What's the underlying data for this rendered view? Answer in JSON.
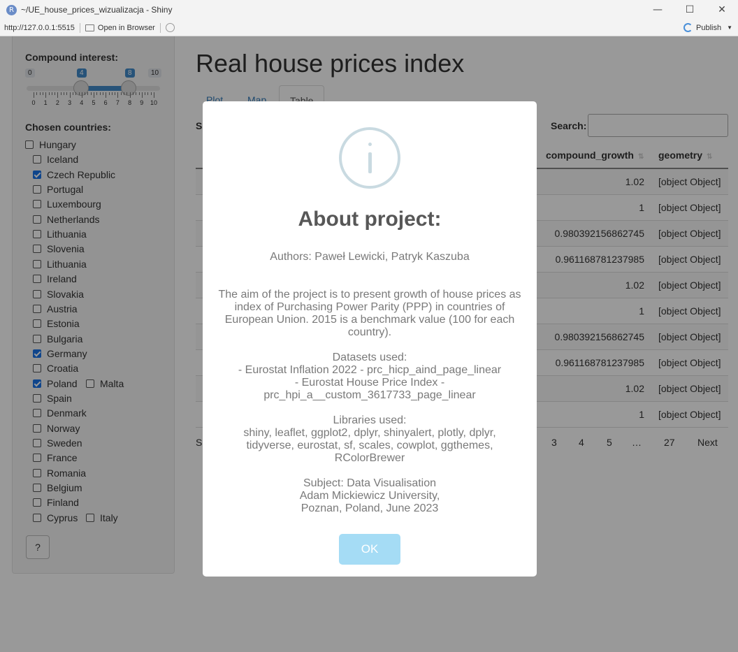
{
  "window": {
    "app_icon": "R",
    "title": "~/UE_house_prices_wizualizacja - Shiny",
    "minimize": "—",
    "maximize": "☐",
    "close": "✕"
  },
  "addressbar": {
    "url": "http://127.0.0.1:5515",
    "open_in_browser": "Open in Browser",
    "publish": "Publish"
  },
  "sidebar": {
    "compound_label": "Compound interest:",
    "slider": {
      "min": "0",
      "max": "10",
      "from": "4",
      "to": "8",
      "from_value": 4,
      "to_value": 8,
      "min_value": 0,
      "max_value": 10,
      "tick_labels": [
        "0",
        "1",
        "2",
        "3",
        "4",
        "5",
        "6",
        "7",
        "8",
        "9",
        "10"
      ]
    },
    "countries_label": "Chosen countries:",
    "countries": [
      {
        "name": "Hungary",
        "checked": false
      },
      {
        "name": "Iceland",
        "checked": false
      },
      {
        "name": "Czech Republic",
        "checked": true
      },
      {
        "name": "Portugal",
        "checked": false
      },
      {
        "name": "Luxembourg",
        "checked": false
      },
      {
        "name": "Netherlands",
        "checked": false
      },
      {
        "name": "Lithuania",
        "checked": false
      },
      {
        "name": "Slovenia",
        "checked": false
      },
      {
        "name": "Lithuania",
        "checked": false
      },
      {
        "name": "Ireland",
        "checked": false
      },
      {
        "name": "Slovakia",
        "checked": false
      },
      {
        "name": "Austria",
        "checked": false
      },
      {
        "name": "Estonia",
        "checked": false
      },
      {
        "name": "Bulgaria",
        "checked": false
      },
      {
        "name": "Germany",
        "checked": true
      },
      {
        "name": "Croatia",
        "checked": false
      },
      {
        "name": "Poland",
        "checked": true
      },
      {
        "name": "Malta",
        "checked": false
      },
      {
        "name": "Spain",
        "checked": false
      },
      {
        "name": "Denmark",
        "checked": false
      },
      {
        "name": "Norway",
        "checked": false
      },
      {
        "name": "Sweden",
        "checked": false
      },
      {
        "name": "France",
        "checked": false
      },
      {
        "name": "Romania",
        "checked": false
      },
      {
        "name": "Belgium",
        "checked": false
      },
      {
        "name": "Finland",
        "checked": false
      },
      {
        "name": "Cyprus",
        "checked": false
      },
      {
        "name": "Italy",
        "checked": false
      }
    ],
    "help": "?"
  },
  "main": {
    "title": "Real house prices index",
    "tabs": [
      "Plot",
      "Map",
      "Table"
    ],
    "show_label": "S",
    "search_label": "Search:",
    "columns": [
      "compound_growth",
      "geometry"
    ],
    "rows": [
      {
        "compound_growth": "1.02",
        "geometry": "[object Object]"
      },
      {
        "compound_growth": "1",
        "geometry": "[object Object]"
      },
      {
        "compound_growth": "0.980392156862745",
        "geometry": "[object Object]"
      },
      {
        "compound_growth": "0.961168781237985",
        "geometry": "[object Object]"
      },
      {
        "compound_growth": "1.02",
        "geometry": "[object Object]"
      },
      {
        "compound_growth": "1",
        "geometry": "[object Object]"
      },
      {
        "compound_growth": "0.980392156862745",
        "geometry": "[object Object]"
      },
      {
        "compound_growth": "0.961168781237985",
        "geometry": "[object Object]"
      },
      {
        "compound_growth": "1.02",
        "geometry": "[object Object]"
      },
      {
        "compound_growth": "1",
        "geometry": "[object Object]"
      }
    ],
    "showing": "S",
    "pagination": [
      "3",
      "4",
      "5",
      "…",
      "27",
      "Next"
    ]
  },
  "modal": {
    "title": "About project:",
    "authors": "Authors: Paweł Lewicki, Patryk Kaszuba",
    "aim_lines": [
      "The aim of the project is to present growth of house prices as",
      "index of Purchasing Power Parity (PPP) in countries of",
      "European Union. 2015 is a benchmark value (100 for each",
      "country)."
    ],
    "datasets_lines": [
      "Datasets used:",
      "- Eurostat Inflation 2022 - prc_hicp_aind_page_linear",
      "- Eurostat House Price Index -",
      "prc_hpi_a__custom_3617733_page_linear"
    ],
    "libraries_lines": [
      "Libraries used:",
      "shiny, leaflet, ggplot2, dplyr, shinyalert, plotly, dplyr,",
      "tidyverse, eurostat, sf, scales, cowplot, ggthemes,",
      "RColorBrewer"
    ],
    "subject_lines": [
      "Subject: Data Visualisation",
      "Adam Mickiewicz University,",
      "Poznan, Poland, June 2023"
    ],
    "ok": "OK",
    "icon": "info-icon"
  }
}
